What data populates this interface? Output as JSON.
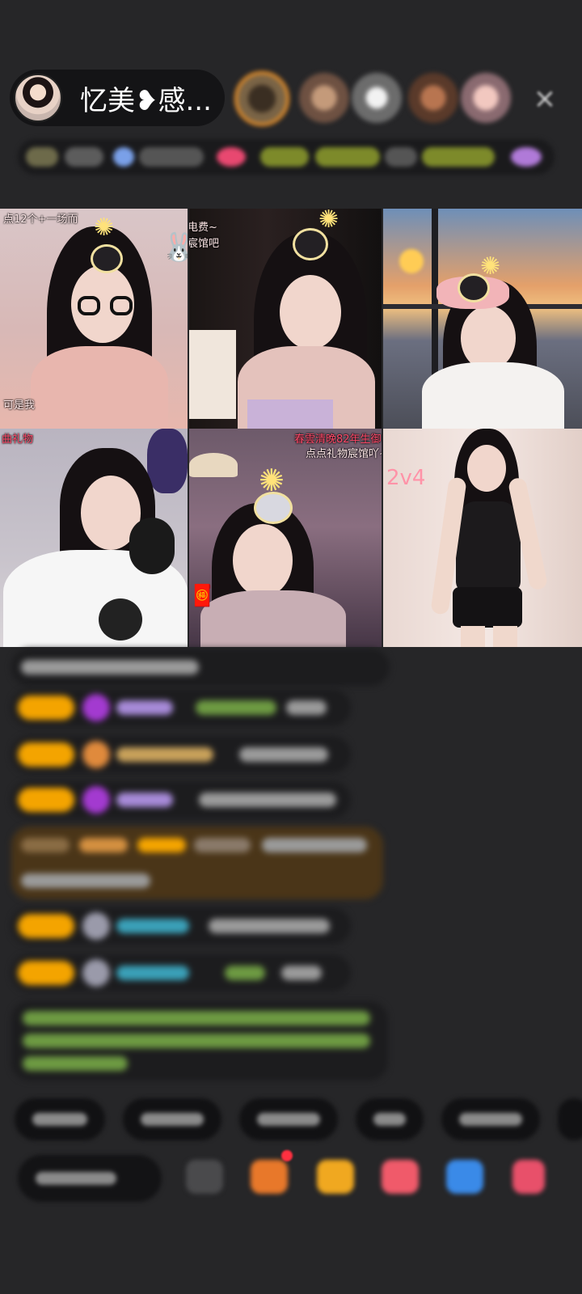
{
  "host": {
    "name": "忆美❥感...",
    "avatar_icon": "host-avatar"
  },
  "viewers": [
    "viewer-avatar",
    "viewer-avatar",
    "viewer-avatar",
    "viewer-avatar",
    "viewer-avatar"
  ],
  "close_icon": "×",
  "video_overlays": {
    "tile1_top": "点12个+一场而",
    "tile1_bottom": "可是我",
    "tile2_line1": "电费~",
    "tile2_line2": "宸馆吧",
    "tile4_top": "曲礼物",
    "tile5_line1": "春雲清晚82年生御",
    "tile5_line2": "点点礼物宸馆吖~",
    "tile6_tag": "2v4"
  },
  "colors": {
    "background": "#262628",
    "badge": "#f4a400",
    "pill": "#141416"
  }
}
